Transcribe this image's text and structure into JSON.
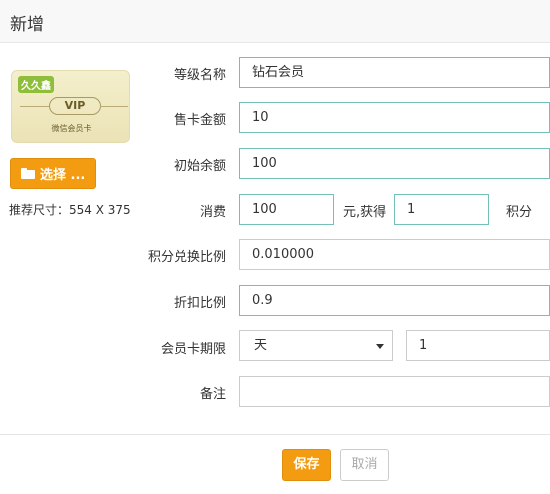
{
  "header": {
    "title": "新增"
  },
  "card": {
    "logo_text": "久久鑫",
    "vip_text": "VIP",
    "caption": "微信会员卡",
    "choose_label": "选择 ...",
    "size_hint": "推荐尺寸：554 X 375"
  },
  "form": {
    "level_name": {
      "label": "等级名称",
      "value": "钻石会员"
    },
    "card_price": {
      "label": "售卡金额",
      "value": "10"
    },
    "initial_balance": {
      "label": "初始余额",
      "value": "100"
    },
    "spend": {
      "label": "消费",
      "value": "100",
      "middle": "元,获得",
      "points_value": "1",
      "suffix": "积分"
    },
    "points_ratio": {
      "label": "积分兑换比例",
      "value": "0.010000"
    },
    "discount": {
      "label": "折扣比例",
      "value": "0.9"
    },
    "validity": {
      "label": "会员卡期限",
      "unit": "天",
      "value": "1"
    },
    "remark": {
      "label": "备注",
      "value": ""
    }
  },
  "footer": {
    "save_label": "保存",
    "cancel_label": "取消"
  },
  "colors": {
    "accent": "#f39c12",
    "focus_border": "#72c0b8"
  }
}
